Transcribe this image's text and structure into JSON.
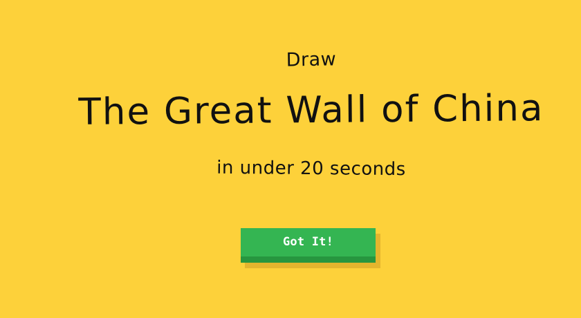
{
  "colors": {
    "background": "#FDD13A",
    "text": "#111111",
    "button_face": "#34B552",
    "button_edge": "#27963F",
    "button_text": "#FFFFFF"
  },
  "prompt": {
    "prefix": "Draw",
    "subject": "The Great Wall of China",
    "suffix": "in under 20 seconds"
  },
  "actions": {
    "confirm_label": "Got It!"
  }
}
